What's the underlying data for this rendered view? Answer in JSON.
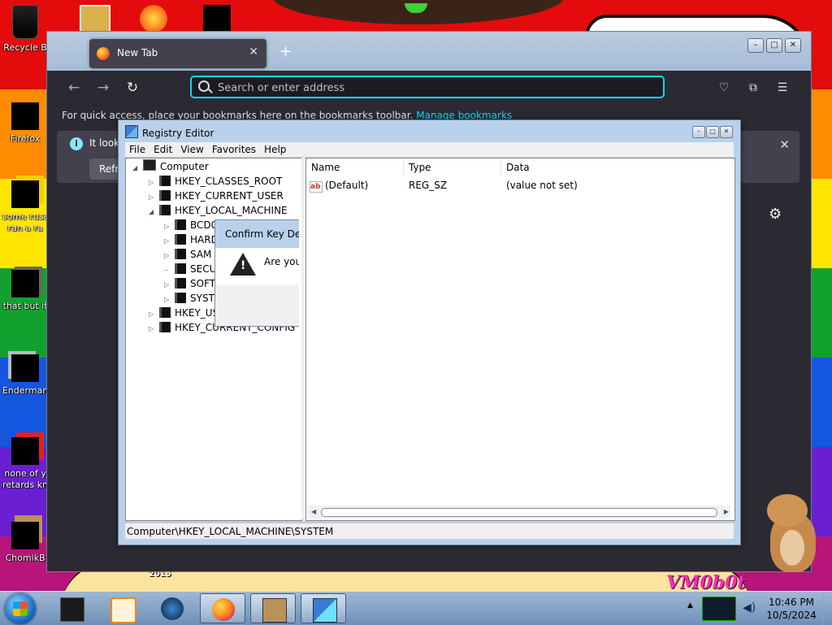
{
  "desktop": {
    "icons": [
      {
        "label": "Recycle B"
      },
      {
        "label": "Firefox"
      },
      {
        "label": "some russ"
      },
      {
        "label": "ran a ra"
      },
      {
        "label": "that but it"
      },
      {
        "label": "Enderman"
      },
      {
        "label": "none of y"
      },
      {
        "label": "retards kn"
      },
      {
        "label": "ChomikB"
      }
    ],
    "wallpaper_year": "2015",
    "wallpaper_signature": "VM0b0t"
  },
  "firefox": {
    "tab_title": "New Tab",
    "url_placeholder": "Search or enter address",
    "bookmarks_text": "For quick access, place your bookmarks here on the bookmarks toolbar.",
    "bookmarks_link": "Manage bookmarks",
    "notification_text": "It look",
    "notification_button": "Refr"
  },
  "regedit": {
    "title": "Registry Editor",
    "menu": [
      "File",
      "Edit",
      "View",
      "Favorites",
      "Help"
    ],
    "tree": [
      {
        "label": "Computer",
        "level": 0
      },
      {
        "label": "HKEY_CLASSES_ROOT",
        "level": 1
      },
      {
        "label": "HKEY_CURRENT_USER",
        "level": 1
      },
      {
        "label": "HKEY_LOCAL_MACHINE",
        "level": 1
      },
      {
        "label": "BCD0",
        "level": 2
      },
      {
        "label": "HARD",
        "level": 2
      },
      {
        "label": "SAM",
        "level": 2
      },
      {
        "label": "SECU",
        "level": 2
      },
      {
        "label": "SOFT",
        "level": 2
      },
      {
        "label": "SYSTI",
        "level": 2
      },
      {
        "label": "HKEY_US",
        "level": 1
      },
      {
        "label": "HKEY_CURRENT_CONFIG",
        "level": 1
      }
    ],
    "columns": [
      "Name",
      "Type",
      "Data"
    ],
    "values": [
      {
        "name": "(Default)",
        "type": "REG_SZ",
        "data": "(value not set)"
      }
    ],
    "status_path": "Computer\\HKEY_LOCAL_MACHINE\\SYSTEM"
  },
  "dialog": {
    "title": "Confirm Key Dele",
    "message": "Are you"
  },
  "taskbar": {
    "time": "10:46 PM",
    "date": "10/5/2024"
  }
}
